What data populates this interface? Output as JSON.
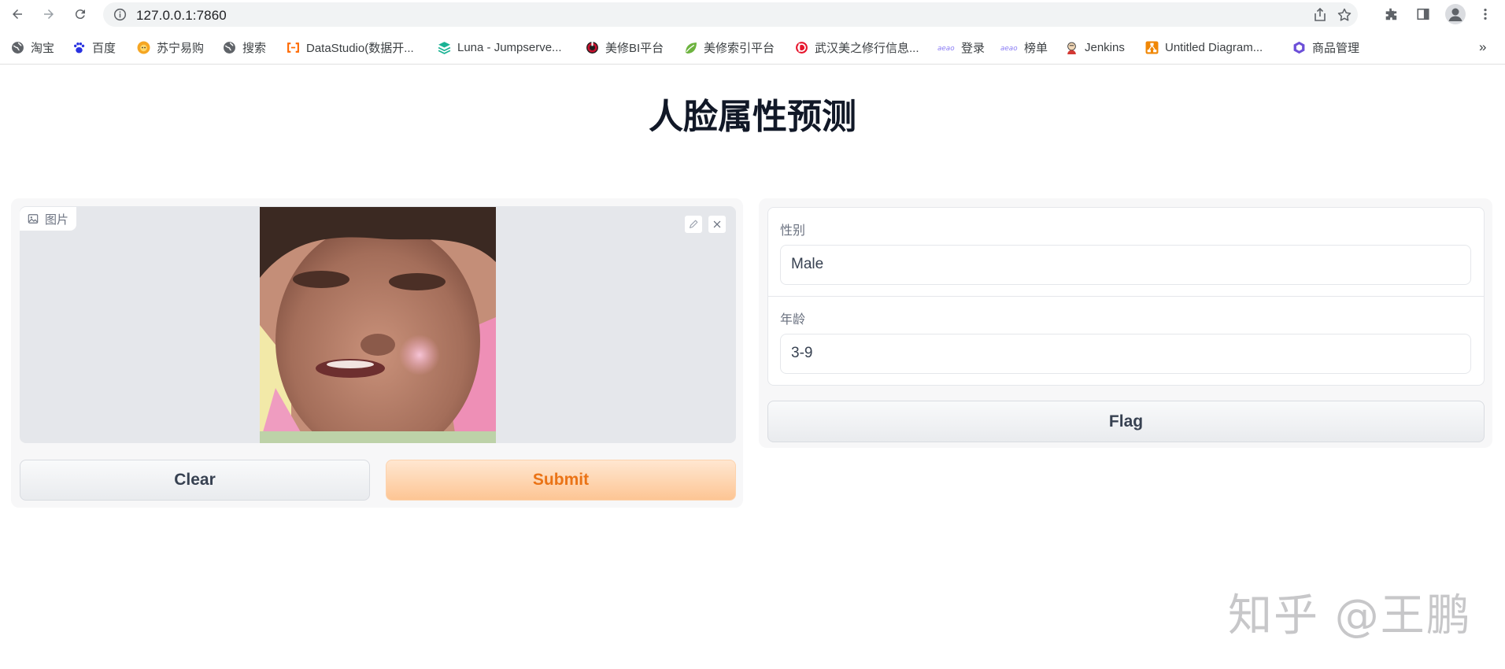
{
  "browser": {
    "url": "127.0.0.1:7860",
    "bookmarks": [
      {
        "label": "淘宝",
        "icon": "globe-icon",
        "color": "#5f6368"
      },
      {
        "label": "百度",
        "icon": "baidu-paw-icon",
        "color": "#2932e1"
      },
      {
        "label": "苏宁易购",
        "icon": "suning-lion-icon",
        "color": "#f5a623"
      },
      {
        "label": "搜索",
        "icon": "globe-icon",
        "color": "#5f6368"
      },
      {
        "label": "DataStudio(数据开...",
        "icon": "aliyun-bracket-icon",
        "color": "#ff6a00"
      },
      {
        "label": "Luna - Jumpserve...",
        "icon": "jumpserver-stack-icon",
        "color": "#1ab394"
      },
      {
        "label": "美修BI平台",
        "icon": "bi-ring-icon",
        "color": "#c8102e"
      },
      {
        "label": "美修索引平台",
        "icon": "spring-leaf-icon",
        "color": "#6db33f"
      },
      {
        "label": "武汉美之修行信息...",
        "icon": "weibo-icon",
        "color": "#e6162d"
      },
      {
        "label": "登录",
        "icon": "aeae-icon",
        "color": "#8a7cf5"
      },
      {
        "label": "榜单",
        "icon": "aeae-icon",
        "color": "#8a7cf5"
      },
      {
        "label": "Jenkins",
        "icon": "jenkins-icon",
        "color": "#d33833"
      },
      {
        "label": "Untitled Diagram...",
        "icon": "drawio-icon",
        "color": "#f08705"
      },
      {
        "label": "商品管理",
        "icon": "hexagon-icon",
        "color": "#6c4fd8"
      }
    ],
    "more_bookmarks": "»"
  },
  "app": {
    "title": "人脸属性预测",
    "image_input": {
      "label": "图片"
    },
    "clear_label": "Clear",
    "submit_label": "Submit",
    "outputs": [
      {
        "label": "性别",
        "value": "Male"
      },
      {
        "label": "年龄",
        "value": "3-9"
      }
    ],
    "flag_label": "Flag"
  },
  "watermark": "知乎 @王鹏",
  "colors": {
    "submit_text": "#ea7316",
    "submit_bg_top": "#ffe7d1",
    "submit_bg_bottom": "#fdc594",
    "panel_bg": "#f7f7f8"
  }
}
